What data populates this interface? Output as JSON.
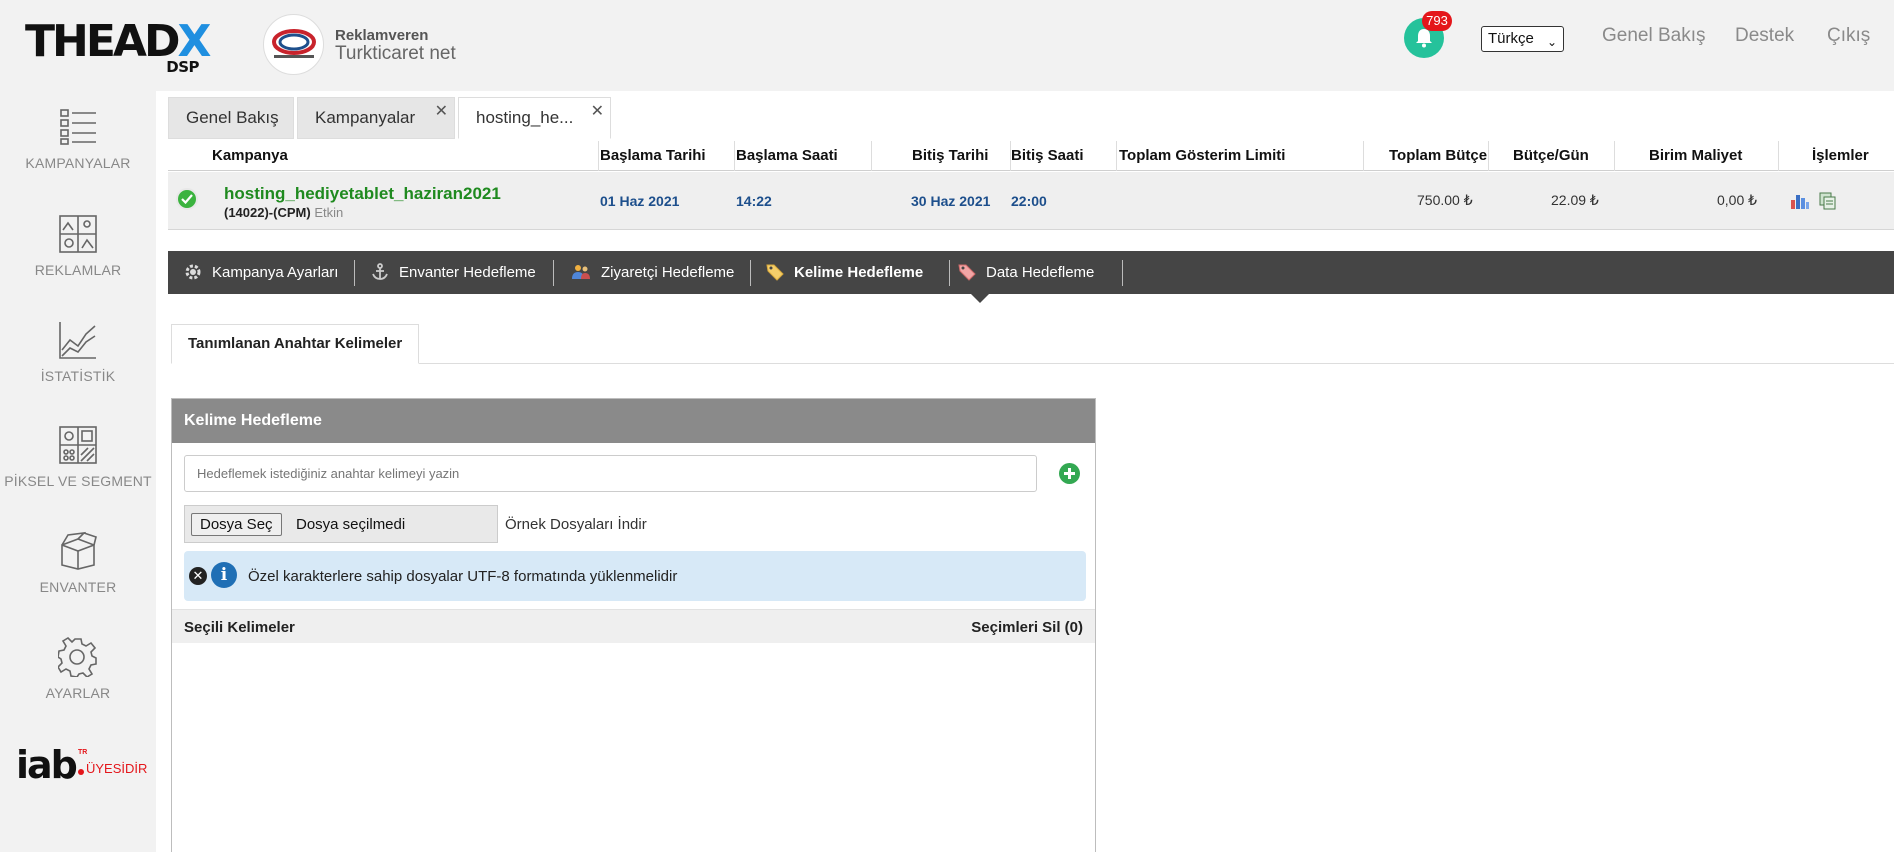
{
  "header": {
    "logo_text_a": "THEAD",
    "logo_text_x": "X",
    "logo_sub": "DSP",
    "advertiser_label": "Reklamveren",
    "advertiser_name": "Turkticaret net",
    "notification_count": "793",
    "language": "Türkçe",
    "links": {
      "overview": "Genel Bakış",
      "support": "Destek",
      "logout": "Çıkış"
    }
  },
  "sidebar": {
    "items": [
      {
        "label": "KAMPANYALAR",
        "icon": "campaign-list-icon"
      },
      {
        "label": "REKLAMLAR",
        "icon": "ads-gallery-icon"
      },
      {
        "label": "İSTATİSTİK",
        "icon": "statistics-chart-icon"
      },
      {
        "label": "PİKSEL VE SEGMENT",
        "icon": "pixel-segment-icon"
      },
      {
        "label": "ENVANTER",
        "icon": "inventory-box-icon"
      },
      {
        "label": "AYARLAR",
        "icon": "gear-icon"
      }
    ],
    "iab": {
      "main": "iab",
      "tr": "TR",
      "sub": "ÜYESİDİR"
    }
  },
  "tabs": [
    {
      "label": "Genel Bakış"
    },
    {
      "label": "Kampanyalar"
    },
    {
      "label": "hosting_he..."
    }
  ],
  "campaign_table": {
    "headers": {
      "campaign": "Kampanya",
      "start_date": "Başlama Tarihi",
      "start_time": "Başlama Saati",
      "end_date": "Bitiş Tarihi",
      "end_time": "Bitiş Saati",
      "impression_limit": "Toplam Gösterim Limiti",
      "total_budget": "Toplam Bütçe",
      "daily_budget": "Bütçe/Gün",
      "unit_cost": "Birim Maliyet",
      "actions": "İşlemler"
    },
    "row": {
      "name": "hosting_hediyetablet_haziran2021",
      "meta": "(14022)-(CPM)",
      "status": "Etkin",
      "start_date": "01 Haz 2021",
      "start_time": "14:22",
      "end_date": "30 Haz 2021",
      "end_time": "22:00",
      "impression_limit": "",
      "total_budget": "750.00 ₺",
      "daily_budget": "22.09 ₺",
      "unit_cost": "0,00 ₺"
    }
  },
  "toolbar": {
    "items": [
      {
        "label": "Kampanya Ayarları",
        "icon": "gear-icon"
      },
      {
        "label": "Envanter Hedefleme",
        "icon": "anchor-icon"
      },
      {
        "label": "Ziyaretçi Hedefleme",
        "icon": "visitors-icon"
      },
      {
        "label": "Kelime Hedefleme",
        "icon": "tag-icon",
        "active": true
      },
      {
        "label": "Data Hedefleme",
        "icon": "tag-icon"
      }
    ]
  },
  "subtab": {
    "label": "Tanımlanan Anahtar Kelimeler"
  },
  "panel": {
    "title": "Kelime Hedefleme",
    "keyword_placeholder": "Hedeflemek istediğiniz anahtar kelimeyi yazin",
    "file_button": "Dosya Seç",
    "file_status": "Dosya seçilmedi",
    "sample_link": "Örnek Dosyaları İndir",
    "info_text": "Özel karakterlere sahip dosyalar UTF-8 formatında yüklenmelidir",
    "selected_title": "Seçili Kelimeler",
    "clear_selection": "Seçimleri Sil (0)"
  },
  "colors": {
    "accent_green": "#25c29b",
    "campaign_green": "#1f8a1f",
    "date_blue": "#1d4f8c",
    "toolbar_dark": "#454545",
    "badge_red": "#e4161b"
  }
}
